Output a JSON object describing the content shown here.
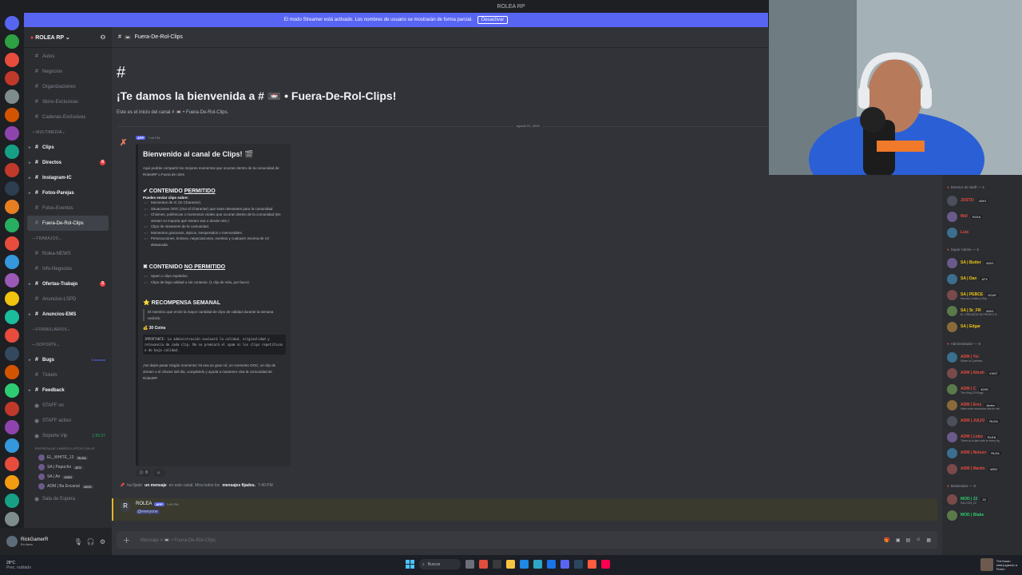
{
  "window": {
    "title": "ROLEA RP"
  },
  "banner": {
    "text": "El modo Streamer está activado. Los nombres de usuario se mostrarán de forma parcial.",
    "button": "Desactivar"
  },
  "server": {
    "name": "ROLEA RP"
  },
  "channels": [
    {
      "type": "channel",
      "glyph": "#",
      "label": "Autos"
    },
    {
      "type": "channel",
      "glyph": "#",
      "label": "Negocios"
    },
    {
      "type": "channel",
      "glyph": "#",
      "label": "Organizaciones"
    },
    {
      "type": "channel",
      "glyph": "#",
      "label": "Skins-Exclusivas"
    },
    {
      "type": "channel",
      "glyph": "#",
      "label": "Cadenas-Exclusivas"
    },
    {
      "type": "category",
      "label": "MULTIMEDIA"
    },
    {
      "type": "channel",
      "glyph": "#",
      "label": "Clips",
      "bold": true,
      "arrow": true
    },
    {
      "type": "channel",
      "glyph": "#",
      "label": "Directos",
      "bold": true,
      "arrow": true,
      "count": "6"
    },
    {
      "type": "channel",
      "glyph": "#",
      "label": "Instagram-IC",
      "bold": true,
      "arrow": true
    },
    {
      "type": "channel",
      "glyph": "#",
      "label": "Fotos-Parejas",
      "bold": true,
      "arrow": true
    },
    {
      "type": "channel",
      "glyph": "#",
      "label": "Fotos-Eventos"
    },
    {
      "type": "channel",
      "glyph": "#",
      "label": "Fuera-De-Rol-Clips",
      "active": true
    },
    {
      "type": "category",
      "label": "TRABAJOS"
    },
    {
      "type": "channel",
      "glyph": "#",
      "label": "Rolea-NEWS"
    },
    {
      "type": "channel",
      "glyph": "#",
      "label": "Info-Negocios"
    },
    {
      "type": "channel",
      "glyph": "#",
      "label": "Ofertas-Trabajo",
      "bold": true,
      "arrow": true,
      "count": "5"
    },
    {
      "type": "channel",
      "glyph": "#",
      "label": "Anuncios-LSPD"
    },
    {
      "type": "channel",
      "glyph": "#",
      "label": "Anuncios-EMS",
      "bold": true,
      "arrow": true
    },
    {
      "type": "category",
      "label": "FORMULARIOS"
    },
    {
      "type": "category",
      "label": "SOPORTE"
    },
    {
      "type": "channel",
      "glyph": "#",
      "label": "Bugs",
      "bold": true,
      "arrow": true,
      "tag": "3 nuevos"
    },
    {
      "type": "channel",
      "glyph": "#",
      "label": "Tickets"
    },
    {
      "type": "channel",
      "glyph": "#",
      "label": "Feedback",
      "bold": true,
      "arrow": true
    },
    {
      "type": "channel",
      "glyph": "◉",
      "label": "STAFF on"
    },
    {
      "type": "channel",
      "glyph": "◉",
      "label": "STAFF activo"
    },
    {
      "type": "channel",
      "glyph": "◉",
      "label": "Soporte Vip",
      "time": "1:50:37"
    }
  ],
  "voice": {
    "note": "ENTREGA DE CARROS LISTOS CON ID",
    "users": [
      {
        "name": "EL_WHITE_13",
        "tag": "RLEA"
      },
      {
        "name": "SA | Papucho",
        "tag": "ATX"
      },
      {
        "name": "SA | Ari",
        "tag": "420G"
      },
      {
        "name": "ADM | Ba Encanal",
        "tag": "420G"
      }
    ],
    "after": "Sala de Espera"
  },
  "user_panel": {
    "name": "RickGamerR",
    "status": "En línea"
  },
  "channel_header": {
    "name": "Fuera-De-Rol-Clips"
  },
  "welcome": {
    "title": "¡Te damos la bienvenida a # 📼 • Fuera-De-Rol-Clips!",
    "subtitle": "Este es el inicio del canal # 📼 • Fuera-De-Rol-Clips."
  },
  "date_divider": "agosto 01, 2026",
  "message1": {
    "app": "APP",
    "time": "7:40 PM",
    "embed": {
      "title": "Bienvenido al canal de Clips! 🎬",
      "intro": "Aquí podrás compartir los mejores momentos que ocurran dentro de la comunidad de RoleaRP o Fuera de roles",
      "allowed_prefix": "✔ CONTENIDO",
      "allowed_word": "PERMITIDO",
      "allowed_lead": "Puedes enviar clips sobre:",
      "allowed_items": [
        "Momentos de IC (In Character).",
        "Situaciones OOC (Out of Character) que sean relevantes para la comunidad",
        "Chismes, polémicas o momentos virales que ocurran dentro de la comunidad (De stream no importa qué stream sea o donde rete.)",
        "Clips de streamers de la comunidad.",
        "Momentos graciosos, épicos, inesperados o memorables.",
        "Persecuciones, tiroteos, negociaciones, eventos y cualquier escena de rol destacada."
      ],
      "forbidden_prefix": "✖ CONTENIDO",
      "forbidden_word": "NO PERMITIDO",
      "forbidden_items": [
        "Spam o clips repetidos.",
        "Clips de baja calidad o sin contexto. (1 clip de más, por favor)"
      ],
      "reward_title": "⭐ RECOMPENSA SEMANAL",
      "reward_quote": "El miembro que envíe la mayor cantidad de clips de calidad durante la semana recibirá:",
      "coins": "💰 30 Coins",
      "code": "IMPORTANTE: La administración evaluará la calidad, originalidad y relevancia de cada clip. No se premiará el spam ni los clips repetitivos o de baja calidad.",
      "outro": "¡No dejes pasar ningún momento! Ya sea un gran rol, un momento OOC, un clip de stream o el chisme del día, compártelo y ayuda a mantener viva la comunidad de RoleaRP."
    },
    "reactions": [
      {
        "emoji": "🎥",
        "count": "8"
      },
      {
        "emoji": "☺",
        "count": ""
      }
    ]
  },
  "pin_notice": {
    "prefix": "ha fijado",
    "bold1": "un mensaje",
    "middle": "en este canal. Mira todos los",
    "bold2": "mensajes fijados.",
    "time": "7:40 PM"
  },
  "message2": {
    "author": "ROLEA",
    "app": "APP",
    "time": "3:49 PM",
    "mention": "@everyone"
  },
  "composer": {
    "placeholder": "Mensaje # 📼 • Fuera-De-Rol-Clips"
  },
  "members": [
    {
      "group": "Director de Staff — 3",
      "items": [
        {
          "name": "JUSTO",
          "tag": "420G",
          "color": "#e74c3c"
        },
        {
          "name": "Wel",
          "tag": "RLEA",
          "color": "#e74c3c"
        },
        {
          "name": "Luis",
          "tag": "",
          "color": "#e74c3c"
        }
      ]
    },
    {
      "group": "Super Admin — 5",
      "items": [
        {
          "name": "SA | Butter",
          "tag": "420G",
          "color": "#f1c40f"
        },
        {
          "name": "SA | Dan",
          "tag": "ATX",
          "color": "#f1c40f"
        },
        {
          "name": "SA | PEBCE",
          "tag": "GOAT",
          "color": "#f1c40f",
          "sub": "Heroes Limited | Rep"
        },
        {
          "name": "SA | Sr_FR",
          "tag": "420G",
          "color": "#f1c40f",
          "sub": "EL CREADOR MI PROPIO R"
        },
        {
          "name": "SA | Edgar",
          "tag": "",
          "color": "#f1c40f"
        }
      ]
    },
    {
      "group": "Administrador — 8",
      "items": [
        {
          "name": "ADM | Yei",
          "tag": "",
          "color": "#e74c3c",
          "sub": "Share la Quemes"
        },
        {
          "name": "ADM | Abrah",
          "tag": "VXNT",
          "color": "#e74c3c"
        },
        {
          "name": "ADM | C",
          "tag": "420G",
          "color": "#e74c3c",
          "sub": "The King Of Kings"
        },
        {
          "name": "ADM | Erss",
          "tag": "Amén",
          "color": "#e74c3c",
          "sub": "Hate when someone hits fix me"
        },
        {
          "name": "ADM | JULIO",
          "tag": "RLEA",
          "color": "#e74c3c"
        },
        {
          "name": "ADM | Lobo",
          "tag": "RLEA",
          "color": "#e74c3c",
          "sub": "There is a dark side to every lig"
        },
        {
          "name": "ADM | Nelson",
          "tag": "RLEA",
          "color": "#e74c3c"
        },
        {
          "name": "ADM | Martin",
          "tag": "420G",
          "color": "#e74c3c"
        }
      ]
    },
    {
      "group": "Moderador — 9",
      "items": [
        {
          "name": "MOD | 22",
          "tag": "22",
          "color": "#2ecc71",
          "sub": "FALCON_22"
        },
        {
          "name": "MOD | Blake",
          "tag": "",
          "color": "#2ecc71"
        }
      ]
    }
  ],
  "taskbar": {
    "weather": "28°C",
    "weather_sub": "Prec. nublado",
    "search": "Buscar",
    "tray_name": "TheYosan",
    "tray_sub": "está jugando a",
    "tray_game": "Fivem"
  }
}
